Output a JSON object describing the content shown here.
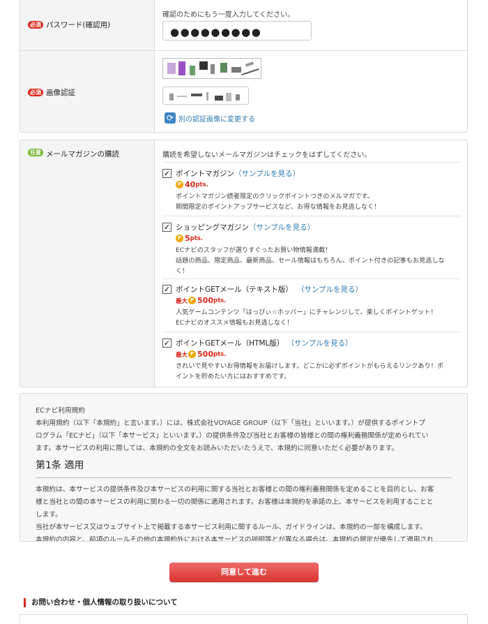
{
  "password_confirm": {
    "required_badge": "必須",
    "label": "パスワード(確認用)",
    "note": "確認のためにもう一度入力してください。",
    "value": "●●●●●●●●●"
  },
  "captcha": {
    "required_badge": "必須",
    "label": "画像認証",
    "refresh_label": "別の認証画像に変更する"
  },
  "newsletter": {
    "optional_badge": "任意",
    "label": "メールマガジンの購読",
    "note": "購読を希望しないメールマガジンはチェックをはずしてください。",
    "items": [
      {
        "name": "ポイントマガジン",
        "sample": "サンプルを見る",
        "checked": "✓",
        "prefix": "",
        "points": "40",
        "unit": "pts.",
        "desc1": "ポイントマガジン読者限定のクリックポイントつきのメルマガです。",
        "desc2": "期間限定のポイントアップサービスなど、お得な情報をお見逃しなく！"
      },
      {
        "name": "ショッピングマガジン",
        "sample": "サンプルを見る",
        "checked": "✓",
        "prefix": "",
        "points": "5",
        "unit": "pts.",
        "desc1": "ECナビのスタッフが選りすぐったお買い物情報満載！",
        "desc2": "話題の商品、限定商品、最新商品、セール情報はもちろん、ポイント付きの記事もお見逃しな",
        "desc3": "く！"
      },
      {
        "name": "ポイントGETメール（テキスト版）",
        "sample": "サンプルを見る",
        "checked": "✓",
        "prefix": "最大",
        "points": "500",
        "unit": "pts.",
        "desc1": "人気ゲームコンテンツ「はっぴぃ☆ホッパー」にチャレンジして、楽しくポイントゲット！",
        "desc2": "ECナビのオススメ情報もお見逃しなく！"
      },
      {
        "name": "ポイントGETメール（HTML版）",
        "sample": "サンプルを見る",
        "checked": "✓",
        "prefix": "最大",
        "points": "500",
        "unit": "pts.",
        "desc1": "きれいで見やすいお得情報をお届けします。どこかに必ずポイントがもらえるリンクあり！ポ",
        "desc2": "イントを貯めたい方にはおすすめです。"
      }
    ]
  },
  "terms": {
    "title": "ECナビ利用規約",
    "intro1": "本利用規約（以下「本規約」と言います。）には、株式会社VOYAGE GROUP（以下「当社」といいます。）が提供するポイントプ",
    "intro2": "ログラム「ECナビ」（以下「本サービス」といいます。）の提供条件及び当社とお客様の皆様との間の権利義務関係が定められてい",
    "intro3": "ます。本サービスの利用に際しては、本規約の全文をお読みいただいたうえで、本規約に同意いただく必要があります。",
    "article1_title": "第1条 適用",
    "article1_p1": "本規約は、本サービスの提供条件及び本サービスの利用に関する当社とお客様との間の権利義務関係を定めることを目的とし、お客",
    "article1_p2": "様と当社との間の本サービスの利用に関わる一切の関係に適用されます。お客様は本規約を承諾の上、本サービスを利用することと",
    "article1_p3": "します。",
    "article1_p4": "当社が本サービス又はウェブサイト上で掲載する本サービス利用に関するルール、ガイドラインは、本規約の一部を構成します。",
    "article1_p5": "本規約の内容と、前項のルールその他の本規約外における本サービスの説明等とが異なる場合は、本規約の規定が優先して適用され"
  },
  "agree_button": "同意して進む",
  "footer_title": "お問い合わせ・個人情報の取り扱いについて",
  "colors": {
    "accent_red": "#d9271e",
    "optional_green": "#72b72f",
    "link_blue": "#2a7ab0"
  }
}
